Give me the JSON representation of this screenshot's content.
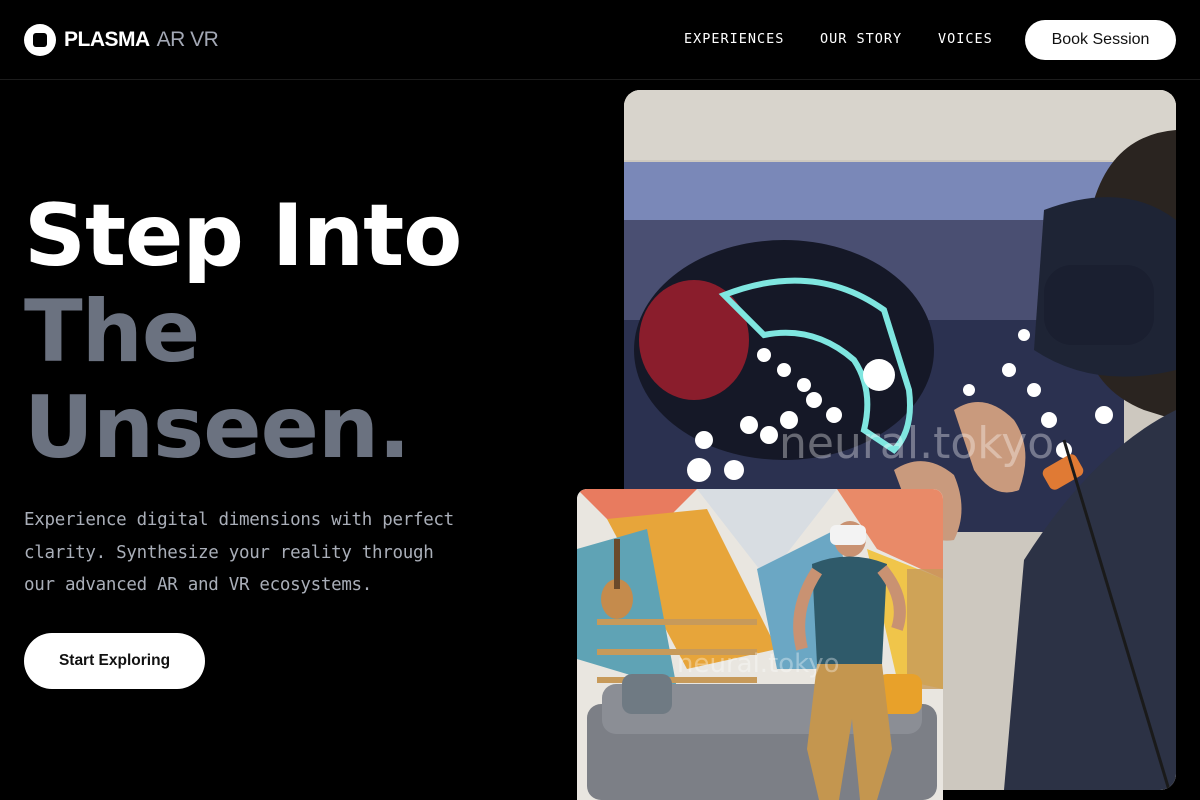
{
  "header": {
    "logo": {
      "brand": "PLASMA",
      "sub": "AR VR"
    },
    "nav": [
      {
        "label": "EXPERIENCES"
      },
      {
        "label": "OUR STORY"
      },
      {
        "label": "VOICES"
      }
    ],
    "cta_label": "Book Session"
  },
  "hero": {
    "title_line1": "Step Into",
    "title_line2": "The",
    "title_line3": "Unseen.",
    "description": "Experience digital dimensions with perfect clarity. Synthesize your reality through our advanced AR and VR ecosystems.",
    "button_label": "Start Exploring"
  },
  "images": {
    "main_watermark": "neural.tokyo",
    "small_watermark": "neural.tokyo"
  },
  "colors": {
    "background": "#000000",
    "title_white": "#ffffff",
    "title_grey": "#6b7280",
    "body_text": "#a9aeb8",
    "button_bg": "#ffffff"
  }
}
